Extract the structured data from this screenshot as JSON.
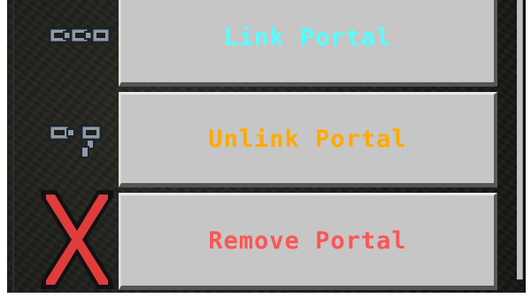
{
  "menu": {
    "buttons": [
      {
        "label": "Link Portal",
        "color": "#55ffff",
        "icon": "chain-link-icon"
      },
      {
        "label": "Unlink Portal",
        "color": "#ffaa00",
        "icon": "broken-chain-icon"
      },
      {
        "label": "Remove Portal",
        "color": "#ff5555",
        "icon": "red-x-icon"
      }
    ]
  },
  "colors": {
    "button_face": "#c6c6c6",
    "panel_background": "#1e1e1a",
    "icon_gray": "#8f9aa6",
    "remove_red": "#e03c3c"
  }
}
